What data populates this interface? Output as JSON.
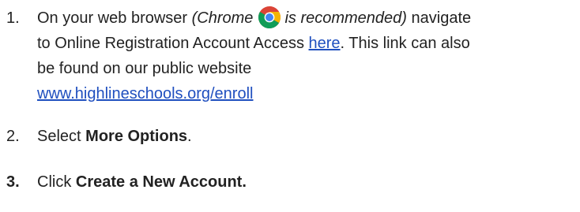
{
  "steps": [
    {
      "number": "1.",
      "lead": "On your web browser ",
      "browser_note_prefix": "(Chrome",
      "browser_icon": "chrome-icon",
      "browser_note_suffix": "is recommended)",
      "after_note": " navigate",
      "line2_text": "to Online Registration Account Access ",
      "link_here": "here",
      "line2_tail": ". This link can also",
      "line3_text": "be found on our public website",
      "website_link": "www.highlineschools.org/enroll"
    },
    {
      "number": "2.",
      "prefix": "Select ",
      "bold": "More Options",
      "suffix": "."
    },
    {
      "number": "3.",
      "prefix": "Click ",
      "bold": "Create a New Account."
    }
  ],
  "colors": {
    "link": "#1f4fbf",
    "text": "#222222"
  }
}
